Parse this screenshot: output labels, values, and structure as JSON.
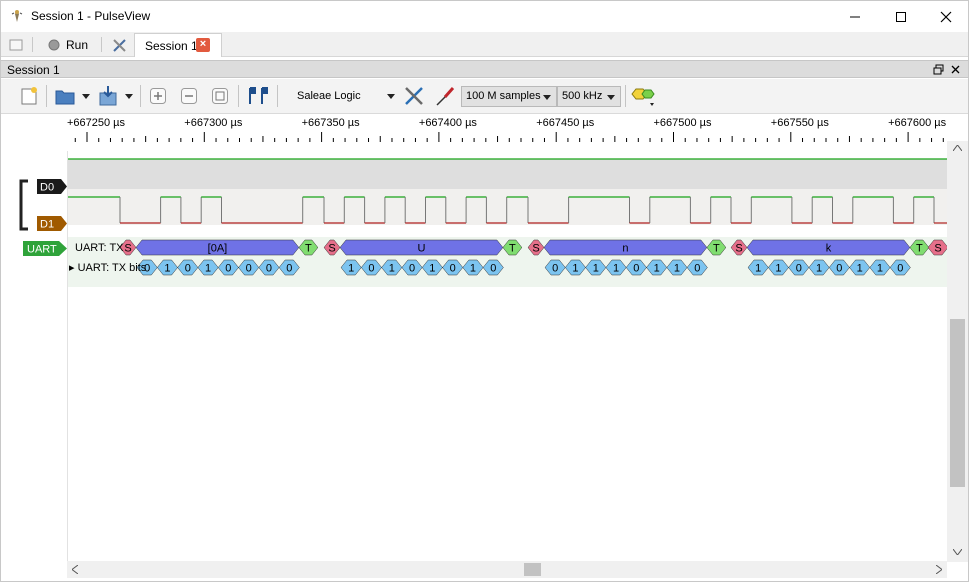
{
  "window": {
    "title": "Session 1 - PulseView",
    "icon": "pulseview-icon"
  },
  "tabbar": {
    "run_label": "Run",
    "session_tab": "Session 1"
  },
  "dock": {
    "title": "Session 1"
  },
  "toolbar": {
    "device": "Saleae Logic",
    "samples": "100 M samples",
    "rate": "500 kHz"
  },
  "ruler": {
    "labels": [
      "+667250 µs",
      "+667300 µs",
      "+667350 µs",
      "+667400 µs",
      "+667450 µs",
      "+667500 µs",
      "+667550 µs",
      "+667600 µs"
    ]
  },
  "channels": {
    "d0": "D0",
    "d1": "D1",
    "uart": "UART"
  },
  "decoder_rows": {
    "tx": "UART: TX",
    "tx_bits": "UART: TX bits"
  },
  "uart_frames": [
    {
      "start": "S",
      "data": "[0A]",
      "stop": "T",
      "bits": [
        "0",
        "1",
        "0",
        "1",
        "0",
        "0",
        "0",
        "0"
      ]
    },
    {
      "start": "S",
      "data": "U",
      "stop": "T",
      "bits": [
        "1",
        "0",
        "1",
        "0",
        "1",
        "0",
        "1",
        "0"
      ]
    },
    {
      "start": "S",
      "data": "n",
      "stop": "T",
      "bits": [
        "0",
        "1",
        "1",
        "1",
        "0",
        "1",
        "1",
        "0"
      ]
    },
    {
      "start": "S",
      "data": "k",
      "stop": "T",
      "bits": [
        "1",
        "1",
        "0",
        "1",
        "0",
        "1",
        "1",
        "0"
      ]
    }
  ],
  "trailing_start": "S",
  "colors": {
    "signal_high": "#18a418",
    "signal_low": "#b02020",
    "d0_tag": "#1a1a1a",
    "d1_tag": "#a05a00",
    "uart_tag": "#2fa33a",
    "data_hex": "#6f72e6",
    "start_hex": "#e66f8a",
    "stop_hex": "#80dd70",
    "bit_hex": "#7cc4f0"
  }
}
